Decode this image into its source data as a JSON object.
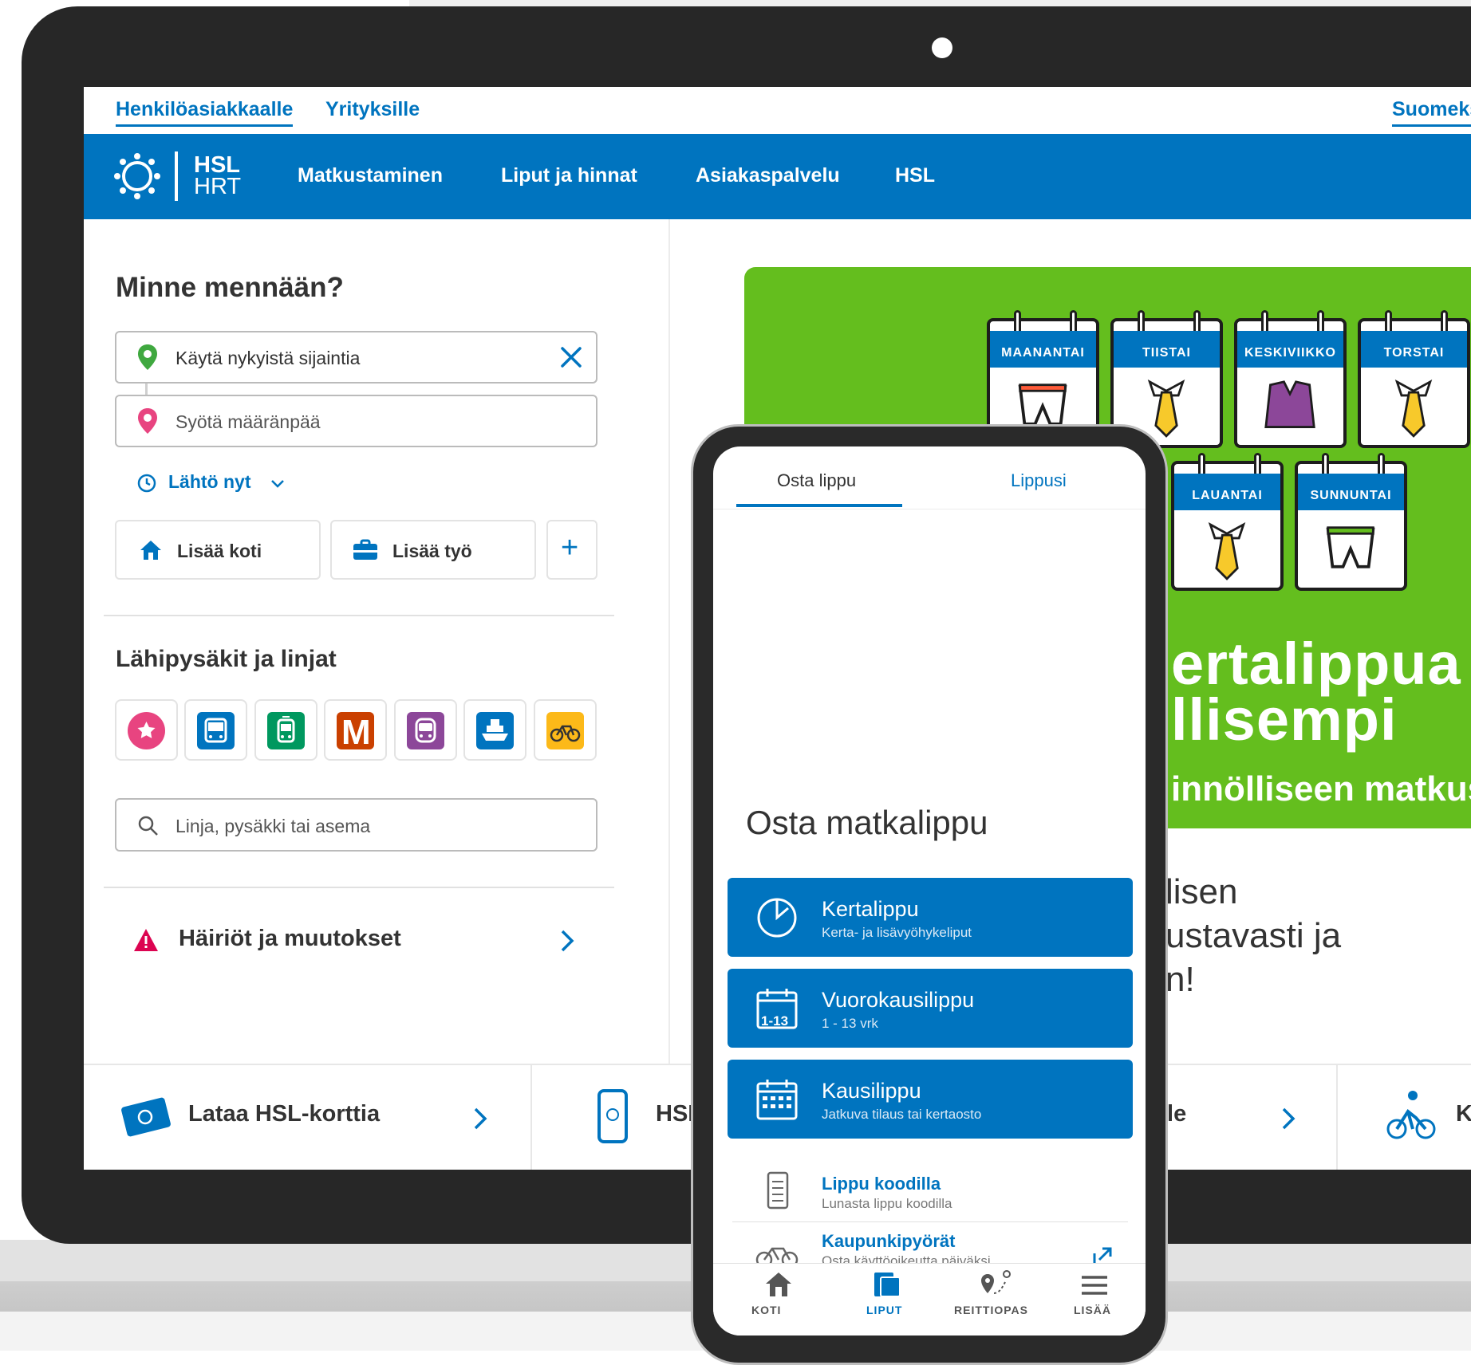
{
  "utility": {
    "personal": "Henkilöasiakkaalle",
    "business": "Yrityksille",
    "language": "Suomeksi"
  },
  "nav": {
    "logo_line1": "HSL",
    "logo_line2": "HRT",
    "items": [
      "Matkustaminen",
      "Liput ja hinnat",
      "Asiakaspalvelu",
      "HSL"
    ]
  },
  "planner": {
    "title": "Minne mennään?",
    "origin_value": "Käytä nykyistä sijaintia",
    "destination_placeholder": "Syötä määränpää",
    "time_label": "Lähtö nyt",
    "add_home": "Lisää koti",
    "add_work": "Lisää työ",
    "add_more": "+"
  },
  "nearby": {
    "title": "Lähipysäkit ja linjat",
    "modes": [
      "favourites-icon",
      "bus-icon",
      "tram-icon",
      "metro-icon",
      "train-icon",
      "ferry-icon",
      "citybike-icon"
    ],
    "metro_letter": "M",
    "search_placeholder": "Linja, pysäkki tai asema"
  },
  "disruptions": {
    "label": "Häiriöt ja muutokset"
  },
  "bottom_strip": {
    "item1": "Lataa HSL-korttia",
    "item2": "HSL",
    "item3": "lle",
    "item4": "K"
  },
  "banner": {
    "days": [
      "MAANANTAI",
      "TIISTAI",
      "KESKIVIIKKO",
      "TORSTAI",
      "LAUANTAI",
      "SUNNUNTAI"
    ],
    "headline1": "ertalippua",
    "headline2": "llisempi",
    "subline": "innölliseen matkus",
    "below1": "lisen",
    "below2": "ustavasti ja",
    "below3": "n!"
  },
  "phone": {
    "tab_buy": "Osta lippu",
    "tab_tickets": "Lippusi",
    "heading": "Osta matkalippu",
    "tiles": [
      {
        "title": "Kertalippu",
        "sub": "Kerta- ja lisävyöhykeliput"
      },
      {
        "title": "Vuorokausilippu",
        "sub": "1 - 13 vrk"
      },
      {
        "title": "Kausilippu",
        "sub": "Jatkuva tilaus tai kertaosto"
      }
    ],
    "day_icon_text": "1-13",
    "code_title": "Lippu koodilla",
    "code_sub": "Lunasta lippu koodilla",
    "bike_title": "Kaupunkipyörät",
    "bike_sub": "Osta käyttöoikeutta päiväksi",
    "bottom_nav": [
      "KOTI",
      "LIPUT",
      "REITTIOPAS",
      "LISÄÄ"
    ]
  },
  "colors": {
    "brand_blue": "#0074bf",
    "banner_green": "#64be1e"
  }
}
